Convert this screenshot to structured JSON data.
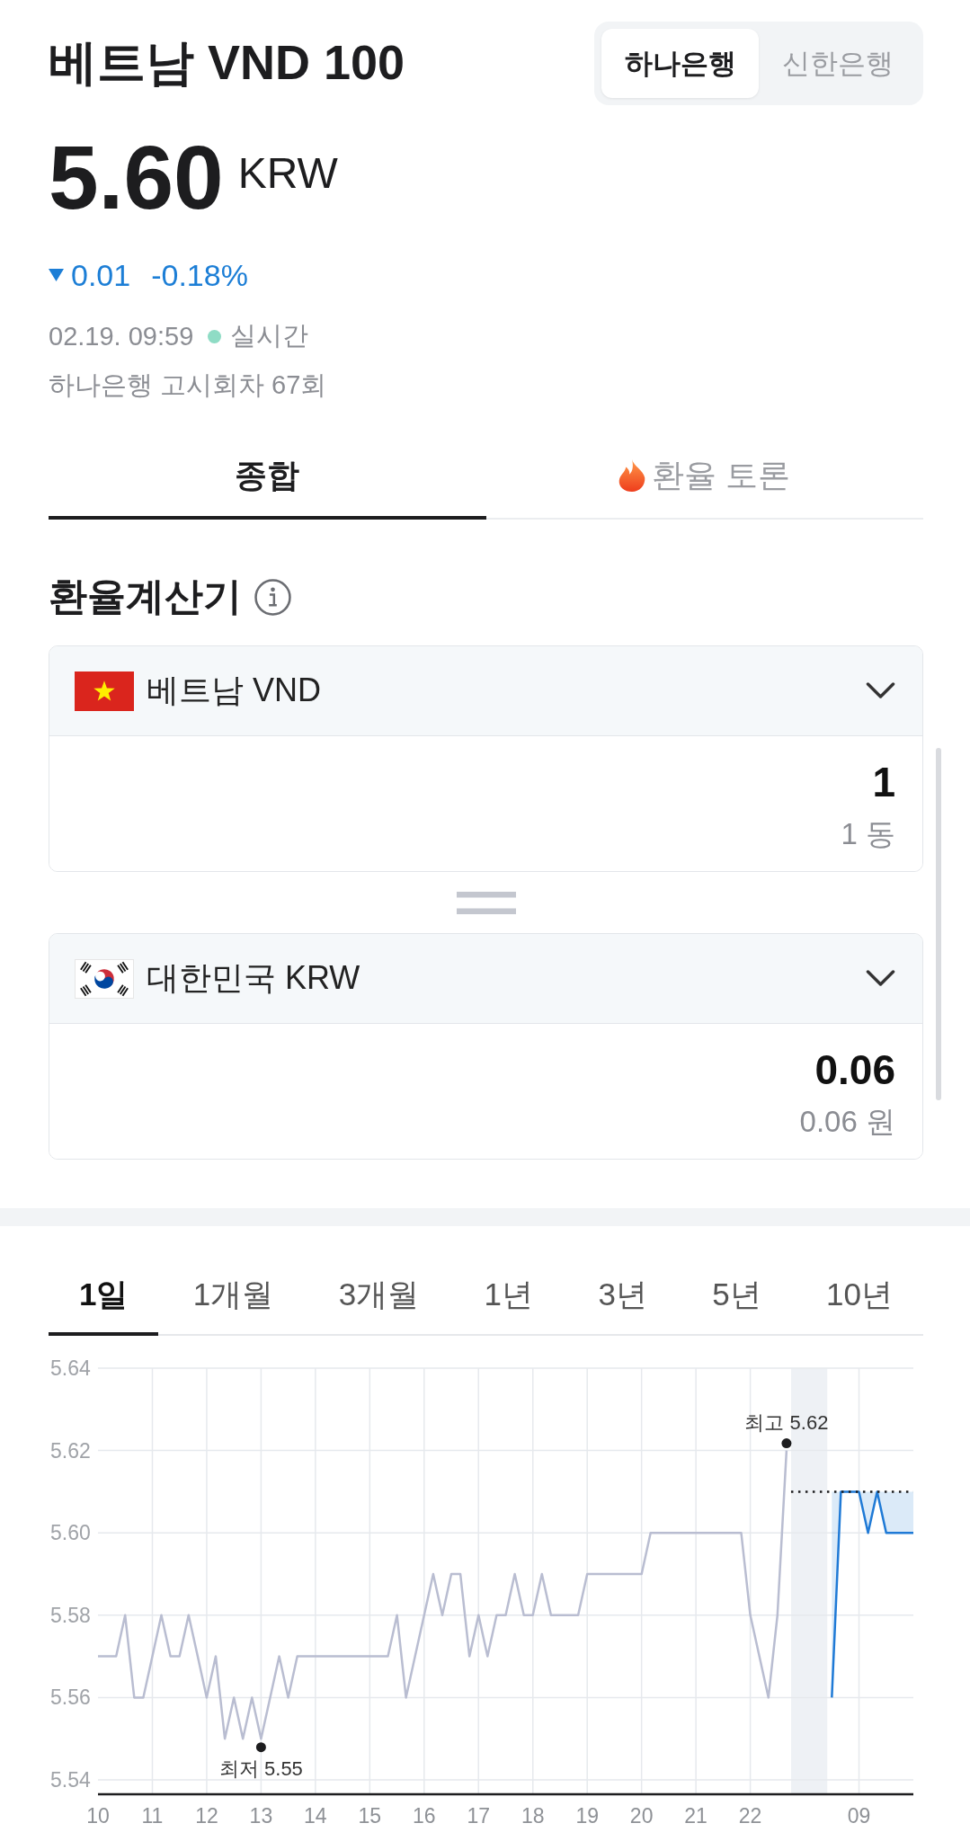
{
  "header": {
    "title": "베트남 VND 100",
    "banks": [
      {
        "label": "하나은행",
        "selected": true
      },
      {
        "label": "신한은행",
        "selected": false
      }
    ]
  },
  "quote": {
    "price": "5.60",
    "unit": "KRW",
    "falling": true,
    "change": "0.01",
    "change_percent": "-0.18%",
    "timestamp": "02.19. 09:59",
    "live": true,
    "live_label": "실시간",
    "notice": "하나은행 고시회차 67회"
  },
  "tabs": [
    {
      "label": "종합",
      "kind": "plain",
      "selected": true
    },
    {
      "label": "환율 토론",
      "kind": "flame",
      "selected": false
    }
  ],
  "calculator": {
    "title": "환율계산기",
    "converters": [
      {
        "kind": "vn",
        "currency": "베트남 VND",
        "value": "1",
        "value_words": "1 동"
      },
      {
        "kind": "kr",
        "currency": "대한민국 KRW",
        "value": "0.06",
        "value_words": "0.06 원"
      }
    ]
  },
  "period_tabs": [
    {
      "label": "1일",
      "selected": true
    },
    {
      "label": "1개월",
      "selected": false
    },
    {
      "label": "3개월",
      "selected": false
    },
    {
      "label": "1년",
      "selected": false
    },
    {
      "label": "3년",
      "selected": false
    },
    {
      "label": "5년",
      "selected": false
    },
    {
      "label": "10년",
      "selected": false
    }
  ],
  "chart": {
    "chart_data": {
      "type": "line",
      "categories": [
        "10",
        null,
        null,
        null,
        null,
        null,
        "11",
        null,
        null,
        null,
        null,
        null,
        "12",
        null,
        null,
        null,
        null,
        null,
        "13",
        null,
        null,
        null,
        null,
        null,
        "14",
        null,
        null,
        null,
        null,
        null,
        "15",
        null,
        null,
        null,
        null,
        null,
        "16",
        null,
        null,
        null,
        null,
        null,
        "17",
        null,
        null,
        null,
        null,
        null,
        "18",
        null,
        null,
        null,
        null,
        null,
        "19",
        null,
        null,
        null,
        null,
        null,
        "20",
        null,
        null,
        null,
        null,
        null,
        "21",
        null,
        null,
        null,
        null,
        null,
        "22",
        null,
        null,
        null,
        null,
        null,
        null,
        null,
        null,
        null,
        null,
        null,
        "09",
        null,
        null,
        null,
        null,
        null,
        null
      ],
      "series": [
        {
          "color": "#b9bdd1",
          "values": [
            5.57,
            5.57,
            5.57,
            5.58,
            5.56,
            5.56,
            5.57,
            5.58,
            5.57,
            5.57,
            5.58,
            5.57,
            5.56,
            5.57,
            5.55,
            5.56,
            5.55,
            5.56,
            5.55,
            5.56,
            5.57,
            5.56,
            5.57,
            5.57,
            5.57,
            5.57,
            5.57,
            5.57,
            5.57,
            5.57,
            5.57,
            5.57,
            5.57,
            5.58,
            5.56,
            5.57,
            5.58,
            5.59,
            5.58,
            5.59,
            5.59,
            5.57,
            5.58,
            5.57,
            5.58,
            5.58,
            5.59,
            5.58,
            5.58,
            5.59,
            5.58,
            5.58,
            5.58,
            5.58,
            5.59,
            5.59,
            5.59,
            5.59,
            5.59,
            5.59,
            5.59,
            5.6,
            5.6,
            5.6,
            5.6,
            5.6,
            5.6,
            5.6,
            5.6,
            5.6,
            5.6,
            5.6,
            5.58,
            5.57,
            5.56,
            5.58,
            5.62,
            null,
            null,
            null,
            null,
            null,
            null,
            null,
            null,
            null,
            null,
            null,
            null,
            null,
            null
          ]
        },
        {
          "color": "#1f7ad6",
          "values": [
            null,
            null,
            null,
            null,
            null,
            null,
            null,
            null,
            null,
            null,
            null,
            null,
            null,
            null,
            null,
            null,
            null,
            null,
            null,
            null,
            null,
            null,
            null,
            null,
            null,
            null,
            null,
            null,
            null,
            null,
            null,
            null,
            null,
            null,
            null,
            null,
            null,
            null,
            null,
            null,
            null,
            null,
            null,
            null,
            null,
            null,
            null,
            null,
            null,
            null,
            null,
            null,
            null,
            null,
            null,
            null,
            null,
            null,
            null,
            null,
            null,
            null,
            null,
            null,
            null,
            null,
            null,
            null,
            null,
            null,
            null,
            null,
            null,
            null,
            null,
            null,
            null,
            null,
            null,
            null,
            null,
            5.56,
            5.61,
            5.61,
            5.61,
            5.6,
            5.61,
            5.6,
            5.6,
            5.6,
            5.6
          ]
        }
      ],
      "ylim": [
        5.5365,
        5.64
      ],
      "yticks": [
        {
          "value": 5.54,
          "label": "5.54"
        },
        {
          "value": 5.56,
          "label": "5.56"
        },
        {
          "value": 5.58,
          "label": "5.58"
        },
        {
          "value": 5.6,
          "label": "5.60"
        },
        {
          "value": 5.62,
          "label": "5.62"
        },
        {
          "value": 5.64,
          "label": "5.64"
        }
      ],
      "grid": true,
      "ref_lines": [
        {
          "axis": "y",
          "value": 5.61
        }
      ],
      "annotations": [
        {
          "text": "최고 5.62",
          "y": 5.62
        },
        {
          "text": "최저 5.55",
          "y": 5.55
        }
      ]
    }
  }
}
